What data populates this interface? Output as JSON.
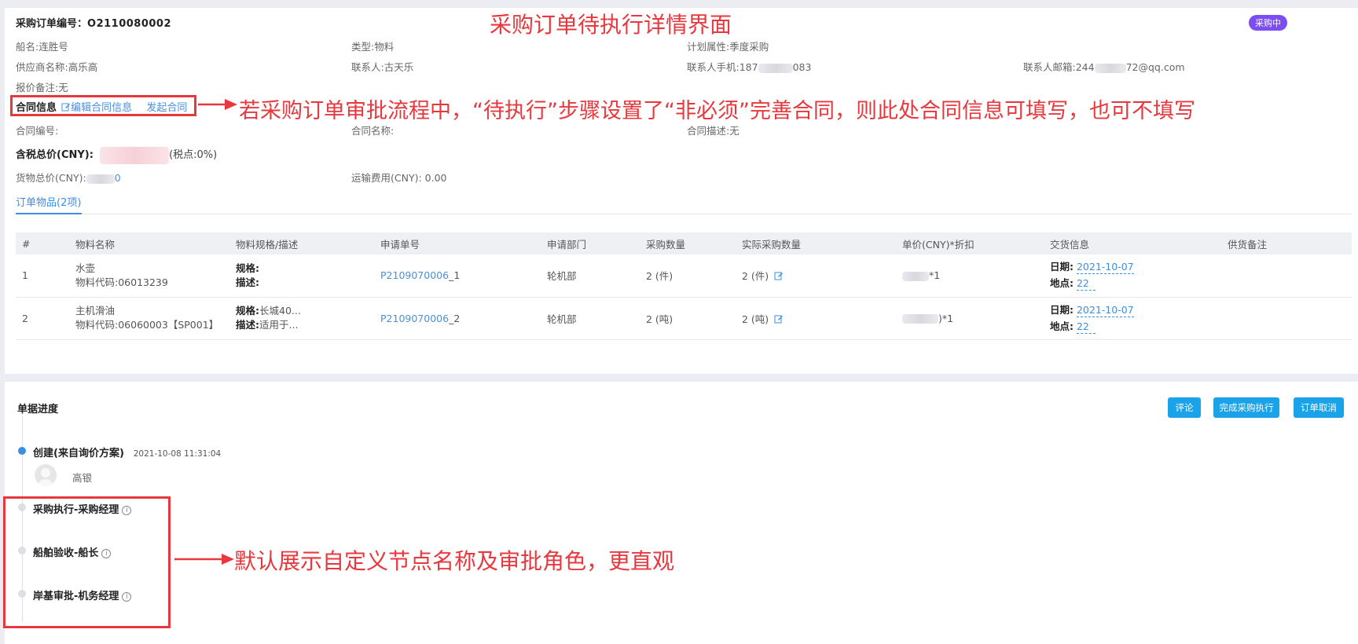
{
  "order": {
    "number_label": "采购订单编号：",
    "number": "O2110080002",
    "status": "采购中",
    "ship": "船名:连胜号",
    "type": "类型:物料",
    "plan": "计划属性:季度采购",
    "supplier": "供应商名称:高乐高",
    "contact": "联系人:古天乐",
    "phone_prefix": "联系人手机:187",
    "phone_suffix": "083",
    "email_prefix": "联系人邮箱:244",
    "email_suffix": "72@qq.com",
    "quote_note": "报价备注:无"
  },
  "contract": {
    "title": "合同信息",
    "edit_label": "编辑合同信息",
    "initiate_label": "发起合同",
    "number": "合同编号:",
    "name": "合同名称:",
    "desc": "合同描述:无"
  },
  "totals": {
    "tax_total_label": "含税总价(CNY):",
    "tax_rate": "(税点:0%)",
    "goods_total_label": "货物总价(CNY):",
    "goods_total_tail": "0",
    "freight": "运输费用(CNY): 0.00"
  },
  "tab": {
    "label": "订单物品(2项)"
  },
  "table": {
    "headers": [
      "#",
      "物料名称",
      "物料规格/描述",
      "申请单号",
      "申请部门",
      "采购数量",
      "实际采购数量",
      "单价(CNY)*折扣",
      "交货信息",
      "供货备注"
    ],
    "rows": [
      {
        "idx": "1",
        "name": "水壶",
        "code": "物料代码:06013239",
        "spec_label": "规格:",
        "spec_value": "",
        "desc_label": "描述:",
        "desc_value": "",
        "req_no": "P2109070006",
        "req_suffix": "_1",
        "dept": "轮机部",
        "qty": "2 (件)",
        "actual_qty": "2 (件)",
        "price_tail": "*1",
        "date_label": "日期:",
        "date": "2021-10-07",
        "place_label": "地点:",
        "place": "22"
      },
      {
        "idx": "2",
        "name": "主机滑油",
        "code": "物料代码:06060003【SP001】",
        "spec_label": "规格:",
        "spec_value": "长城40...",
        "desc_label": "描述:",
        "desc_value": "适用于...",
        "req_no": "P2109070006",
        "req_suffix": "_2",
        "dept": "轮机部",
        "qty": "2 (吨)",
        "actual_qty": "2 (吨)",
        "price_tail": ")*1",
        "date_label": "日期:",
        "date": "2021-10-07",
        "place_label": "地点:",
        "place": "22"
      }
    ]
  },
  "progress": {
    "title": "单据进度",
    "buttons": {
      "comment": "评论",
      "complete": "完成采购执行",
      "cancel": "订单取消"
    },
    "steps": [
      {
        "title": "创建(来自询价方案)",
        "time": "2021-10-08 11:31:04",
        "user": "高银"
      },
      {
        "title": "采购执行-采购经理"
      },
      {
        "title": "船舶验收-船长"
      },
      {
        "title": "岸基审批-机务经理"
      }
    ]
  },
  "annotations": {
    "page_title": "采购订单待执行详情界面",
    "contract_note": "若采购订单审批流程中，“待执行”步骤设置了“非必须”完善合同，则此处合同信息可填写，也可不填写",
    "node_note": "默认展示自定义节点名称及审批角色，更直观"
  },
  "colors": {
    "annotation_red": "#e8383d",
    "status_purple": "#7b4df2",
    "button_blue": "#1aa3e8",
    "link_blue": "#3a8ee6"
  }
}
